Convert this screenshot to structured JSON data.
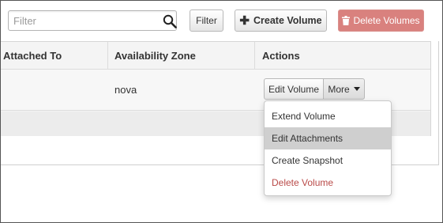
{
  "toolbar": {
    "search_placeholder": "Filter",
    "search_value": "",
    "filter_label": "Filter",
    "create_label": "Create Volume",
    "delete_label": "Delete Volumes"
  },
  "table": {
    "columns": [
      "Attached To",
      "Availability Zone",
      "Actions"
    ],
    "rows": [
      {
        "attached_to": "",
        "availability_zone": "nova"
      }
    ]
  },
  "row_actions": {
    "edit_label": "Edit Volume",
    "more_label": "More"
  },
  "dropdown": {
    "items": [
      {
        "label": "Extend Volume",
        "state": "normal"
      },
      {
        "label": "Edit Attachments",
        "state": "hover"
      },
      {
        "label": "Create Snapshot",
        "state": "normal"
      },
      {
        "label": "Delete Volume",
        "state": "danger"
      }
    ]
  },
  "colors": {
    "danger_button": "#d9817e",
    "danger_text": "#b94a48",
    "hover_item": "#cfcfcf"
  },
  "icons": [
    "search-icon",
    "plus-icon",
    "trash-icon",
    "caret-down-icon"
  ]
}
